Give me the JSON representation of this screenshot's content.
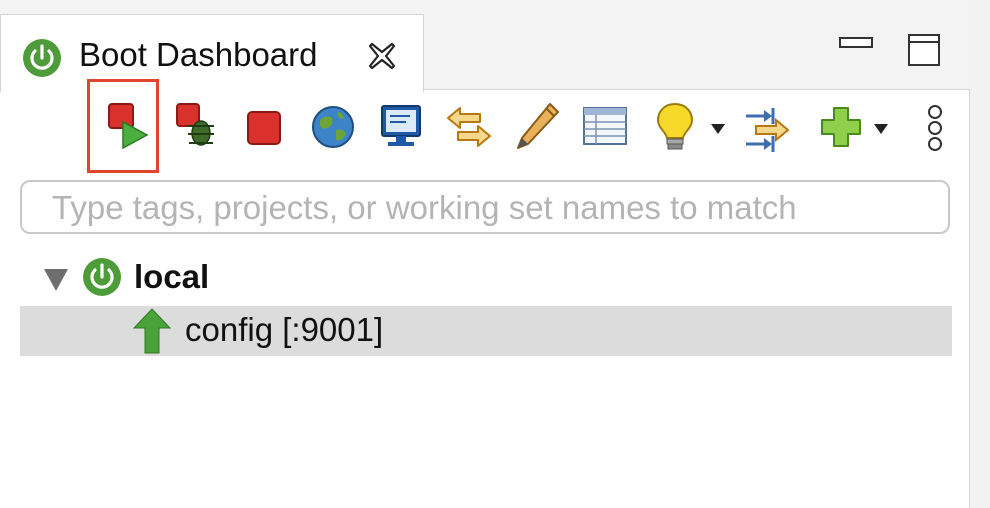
{
  "view": {
    "tab_title": "Boot Dashboard",
    "tab_icon": "spring-power-icon",
    "close_icon": "close-icon",
    "minimize_icon": "minimize-icon",
    "maximize_icon": "maximize-icon"
  },
  "toolbar": {
    "buttons": [
      {
        "name": "restart-button",
        "icon": "restart-icon",
        "highlighted": true
      },
      {
        "name": "debug-button",
        "icon": "debug-bug-icon"
      },
      {
        "name": "stop-button",
        "icon": "stop-icon"
      },
      {
        "name": "open-browser-button",
        "icon": "globe-icon"
      },
      {
        "name": "console-button",
        "icon": "monitor-console-icon"
      },
      {
        "name": "refresh-button",
        "icon": "arrows-swap-icon"
      },
      {
        "name": "edit-button",
        "icon": "pencil-icon"
      },
      {
        "name": "properties-button",
        "icon": "table-icon"
      },
      {
        "name": "live-hover-button",
        "icon": "lightbulb-icon",
        "has_dropdown": true
      },
      {
        "name": "connect-button",
        "icon": "connect-arrows-icon"
      },
      {
        "name": "add-target-button",
        "icon": "plus-icon",
        "has_dropdown": true
      },
      {
        "name": "view-menu-button",
        "icon": "vertical-dots-icon"
      }
    ],
    "highlight_color": "#e0452f"
  },
  "filter": {
    "placeholder": "Type tags, projects, or working set names to match",
    "value": ""
  },
  "tree": {
    "root": {
      "label": "local",
      "expanded": true,
      "icon": "spring-power-icon"
    },
    "children": [
      {
        "label": "config [:9001]",
        "status": "running",
        "icon": "green-up-arrow-icon",
        "selected": true
      }
    ]
  },
  "colors": {
    "spring_green": "#4e9c39",
    "selection_bg": "#dcdcdc",
    "running_green": "#4aa33a"
  }
}
